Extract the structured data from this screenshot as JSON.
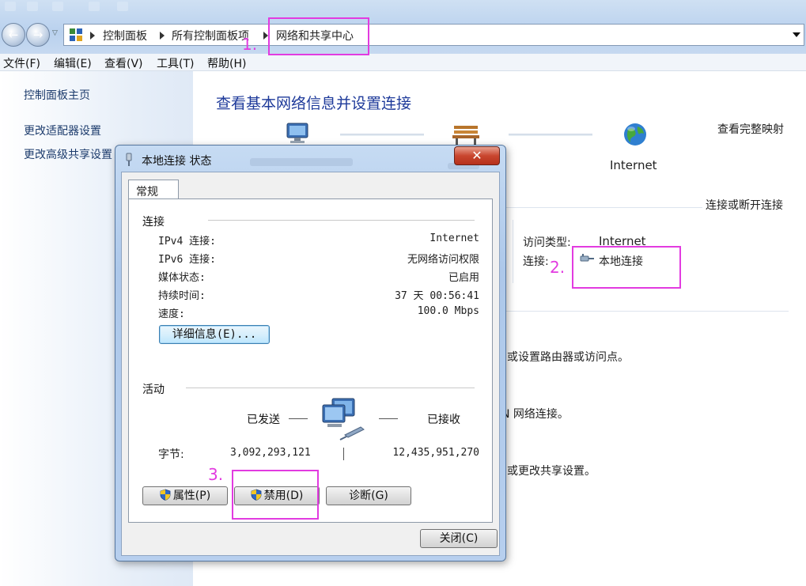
{
  "window": {
    "address": {
      "crumbs": [
        "控制面板",
        "所有控制面板项",
        "网络和共享中心"
      ]
    },
    "menu": [
      "文件(F)",
      "编辑(E)",
      "查看(V)",
      "工具(T)",
      "帮助(H)"
    ]
  },
  "sidebar": {
    "items": [
      {
        "label": "控制面板主页"
      },
      {
        "label": "更改适配器设置"
      },
      {
        "label": "更改高级共享设置"
      }
    ]
  },
  "main": {
    "title": "查看基本网络信息并设置连接",
    "view_full_map": "查看完整映射",
    "internet_label": "Internet",
    "connect_disconnect": "连接或断开连接",
    "access_type_label": "访问类型:",
    "access_type_value": "Internet",
    "connection_label": "连接:",
    "connection_value": "本地连接",
    "text_router": "或设置路由器或访问点。",
    "text_vpn": "N 网络连接。",
    "text_sharing": "或更改共享设置。"
  },
  "dialog": {
    "title": "本地连接 状态",
    "close_glyph": "✕",
    "tab": "常规",
    "connection_group": "连接",
    "rows": [
      {
        "label": "IPv4 连接:",
        "value": "Internet"
      },
      {
        "label": "IPv6 连接:",
        "value": "无网络访问权限"
      },
      {
        "label": "媒体状态:",
        "value": "已启用"
      },
      {
        "label": "持续时间:",
        "value": "37 天 00:56:41"
      },
      {
        "label": "速度:",
        "value": "100.0 Mbps"
      }
    ],
    "details_button": "详细信息(E)...",
    "activity_group": "活动",
    "sent_label": "已发送",
    "received_label": "已接收",
    "bytes_label": "字节:",
    "bytes_sent": "3,092,293,121",
    "bytes_received": "12,435,951,270",
    "properties_button": "属性(P)",
    "disable_button": "禁用(D)",
    "diagnose_button": "诊断(G)",
    "close_button": "关闭(C)"
  },
  "annotations": {
    "step1": "1.",
    "step2": "2.",
    "step3": "3.",
    "color": "#e23be0"
  },
  "colors": {
    "link": "#1a63c6",
    "title": "#1e3a9a",
    "dialog_frame": "#b7cfee"
  }
}
